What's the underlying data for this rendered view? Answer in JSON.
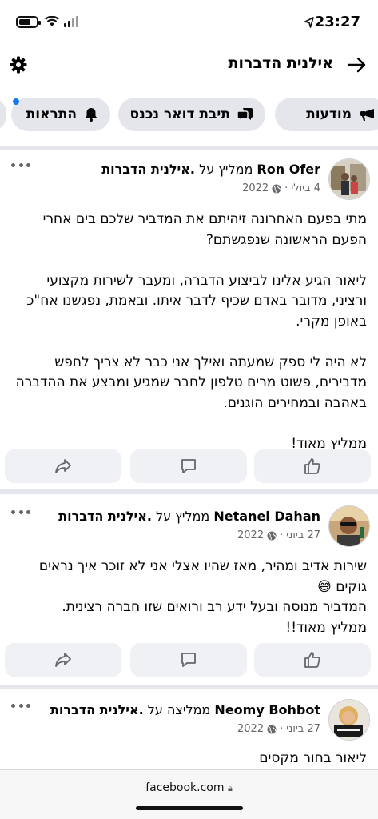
{
  "status_bar": {
    "time": "23:27"
  },
  "header": {
    "title": "אילנית הדברות"
  },
  "tabs": [
    {
      "label": "מודעות",
      "icon": "megaphone-icon"
    },
    {
      "label": "תיבת דואר נכנס",
      "icon": "chat-icon"
    },
    {
      "label": "התראות",
      "icon": "bell-icon"
    }
  ],
  "reviews": [
    {
      "author": "Ron Ofer",
      "verb": "ממליץ על",
      "page": ".אילנית הדברות",
      "date": "4 ביולי",
      "year": "2022",
      "text": "מתי בפעם האחרונה זיהיתם את המדביר שלכם בים אחרי הפעם הראשונה שנפגשתם?\n\nליאור הגיע אלינו לביצוע הדברה, ומעבר לשירות מקצועי ורציני, מדובר באדם שכיף לדבר איתו. ובאמת, נפגשנו אח\"כ באופן מקרי.\n\nלא היה לי ספק שמעתה ואילך אני כבר לא צריך לחפש מדבירים, פשוט מרים טלפון לחבר שמגיע ומבצע את ההדברה באהבה ובמחירים הוגנים.\n\nממליץ מאוד!"
    },
    {
      "author": "Netanel Dahan",
      "verb": "ממליץ על",
      "page": ".אילנית הדברות",
      "date": "27 ביוני",
      "year": "2022",
      "text": "שירות אדיב ומהיר, מאז שהיו אצלי אני לא זוכר איך נראים גוקים 😅\nהמדביר מנוסה ובעל ידע רב ורואים שזו חברה רצינית.\nממליץ מאוד!!"
    },
    {
      "author": "Neomy Bohbot",
      "verb": "ממליצה על",
      "page": ".אילנית הדברות",
      "date": "27 ביוני",
      "year": "2022",
      "text": "ליאור  בחור מקסים"
    }
  ],
  "url_bar": {
    "url": "facebook.com"
  },
  "colors": {
    "accent": "#1877f2",
    "button_bg": "#e4e6eb",
    "meta_gray": "#65676b"
  }
}
